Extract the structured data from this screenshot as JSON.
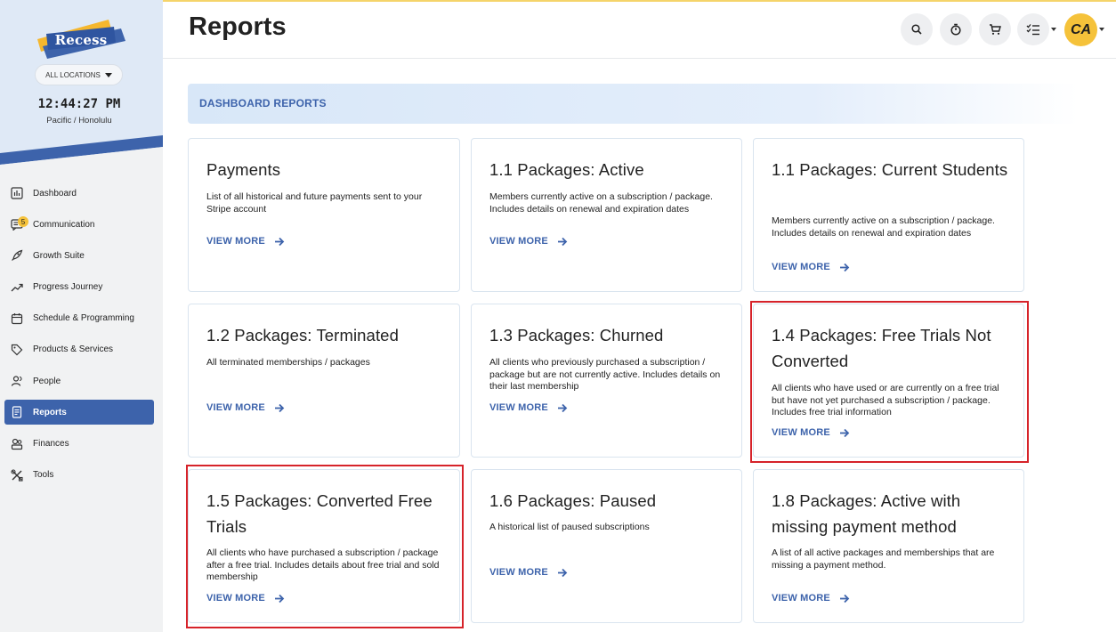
{
  "app": {
    "brand": "Recess",
    "location_selector": "ALL LOCATIONS",
    "clock": "12:44:27 PM",
    "timezone": "Pacific / Honolulu"
  },
  "sidebar": {
    "items": [
      {
        "label": "Dashboard",
        "icon": "dashboard-icon"
      },
      {
        "label": "Communication",
        "icon": "communication-icon",
        "badge": "5"
      },
      {
        "label": "Growth Suite",
        "icon": "rocket-icon"
      },
      {
        "label": "Progress Journey",
        "icon": "trending-up-icon"
      },
      {
        "label": "Schedule & Programming",
        "icon": "calendar-icon"
      },
      {
        "label": "Products & Services",
        "icon": "tag-icon"
      },
      {
        "label": "People",
        "icon": "people-icon"
      },
      {
        "label": "Reports",
        "icon": "reports-icon",
        "active": true
      },
      {
        "label": "Finances",
        "icon": "finances-icon"
      },
      {
        "label": "Tools",
        "icon": "tools-icon"
      }
    ]
  },
  "header": {
    "title": "Reports",
    "avatar_initials": "CA"
  },
  "main": {
    "section_title": "DASHBOARD REPORTS",
    "view_more_label": "VIEW MORE",
    "cards": [
      {
        "title": "Payments",
        "description": "List of all historical and future payments sent to your Stripe account"
      },
      {
        "title": "1.1 Packages: Active",
        "description": "Members currently active on a subscription / package. Includes details on renewal and expiration dates"
      },
      {
        "title": "1.1 Packages: Current Students",
        "description": "Members currently active on a subscription / package. Includes details on renewal and expiration dates"
      },
      {
        "title": "1.2 Packages: Terminated",
        "description": "All terminated memberships / packages"
      },
      {
        "title": "1.3 Packages: Churned",
        "description": "All clients who previously purchased a subscription / package but are not currently active. Includes details on their last membership"
      },
      {
        "title": "1.4 Packages: Free Trials Not Converted",
        "description": "All clients who have used or are currently on a free trial but have not yet purchased a subscription / package. Includes free trial information",
        "highlighted": true
      },
      {
        "title": "1.5 Packages: Converted Free Trials",
        "description": "All clients who have purchased a subscription / package after a free trial. Includes details about free trial and sold membership",
        "highlighted": true
      },
      {
        "title": "1.6 Packages: Paused",
        "description": "A historical list of paused subscriptions"
      },
      {
        "title": "1.8 Packages: Active with missing payment method",
        "description": "A list of all active packages and memberships that are missing a payment method."
      }
    ]
  },
  "colors": {
    "accent": "#3d63ab",
    "brand_yellow": "#f5c23a",
    "highlight": "#d6232a",
    "sidebar_bg": "#f1f2f3"
  }
}
